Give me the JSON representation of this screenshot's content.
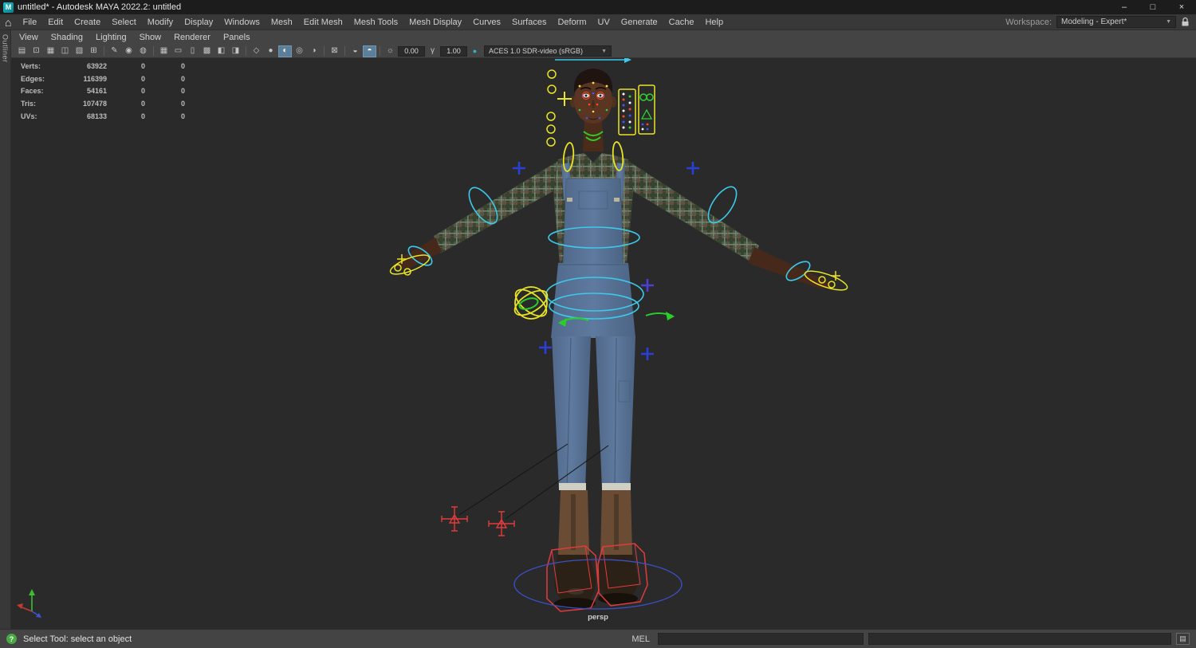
{
  "window": {
    "logo_glyph": "M",
    "title": "untitled* - Autodesk MAYA 2022.2: untitled",
    "controls": {
      "minimize": "–",
      "maximize": "□",
      "close": "×"
    }
  },
  "menu_bar": {
    "home_glyph": "⌂",
    "menus": [
      "File",
      "Edit",
      "Create",
      "Select",
      "Modify",
      "Display",
      "Windows",
      "Mesh",
      "Edit Mesh",
      "Mesh Tools",
      "Mesh Display",
      "Curves",
      "Surfaces",
      "Deform",
      "UV",
      "Generate",
      "Cache",
      "Help"
    ],
    "workspace_label": "Workspace:",
    "workspace_value": "Modeling - Expert*",
    "chevron": "▼"
  },
  "panel_menu": {
    "items": [
      "View",
      "Shading",
      "Lighting",
      "Show",
      "Renderer",
      "Panels"
    ]
  },
  "panel_toolbar": {
    "icons": [
      {
        "name": "select-camera",
        "glyph": "▤"
      },
      {
        "name": "lock-camera",
        "glyph": "⊡"
      },
      {
        "name": "camera-attributes",
        "glyph": "▦"
      },
      {
        "name": "bookmarks",
        "glyph": "◫"
      },
      {
        "name": "image-plane",
        "glyph": "▧"
      },
      {
        "name": "2d-pan-zoom",
        "glyph": "⊞"
      },
      {
        "name": "grease-pencil",
        "glyph": "✎"
      },
      {
        "name": "joints-display",
        "glyph": "◉"
      },
      {
        "name": "deformers-display",
        "glyph": "◍"
      },
      {
        "name": "grid",
        "glyph": "▦"
      },
      {
        "name": "film-gate",
        "glyph": "▭"
      },
      {
        "name": "resolution-gate",
        "glyph": "▯"
      },
      {
        "name": "gate-mask",
        "glyph": "▩"
      },
      {
        "name": "safe-action",
        "glyph": "◧"
      },
      {
        "name": "safe-title",
        "glyph": "◨"
      },
      {
        "name": "wireframe",
        "glyph": "◇"
      },
      {
        "name": "smooth-shade",
        "glyph": "●"
      },
      {
        "name": "textured",
        "glyph": "◐",
        "active": true
      },
      {
        "name": "use-default-material",
        "glyph": "◎"
      },
      {
        "name": "shadows",
        "glyph": "◑"
      },
      {
        "name": "isolate-select",
        "glyph": "⊠"
      },
      {
        "name": "xray",
        "glyph": "◒"
      },
      {
        "name": "lighting",
        "glyph": "◓",
        "active": true
      },
      {
        "name": "exposure",
        "glyph": "☼"
      },
      {
        "name": "gamma",
        "glyph": "γ"
      },
      {
        "name": "colorspace",
        "glyph": "●"
      }
    ],
    "exposure_value": "0.00",
    "gamma_value": "1.00",
    "colorspace": "ACES 1.0 SDR-video (sRGB)"
  },
  "side_tab": "Outliner",
  "hud": {
    "rows": [
      {
        "label": "Verts:",
        "v1": "63922",
        "v2": "0",
        "v3": "0"
      },
      {
        "label": "Edges:",
        "v1": "116399",
        "v2": "0",
        "v3": "0"
      },
      {
        "label": "Faces:",
        "v1": "54161",
        "v2": "0",
        "v3": "0"
      },
      {
        "label": "Tris:",
        "v1": "107478",
        "v2": "0",
        "v3": "0"
      },
      {
        "label": "UVs:",
        "v1": "68133",
        "v2": "0",
        "v3": "0"
      }
    ]
  },
  "viewport": {
    "camera": "persp"
  },
  "status_bar": {
    "help_glyph": "?",
    "help": "Select Tool: select an object",
    "mel_label": "MEL",
    "script_editor_glyph": "▤"
  },
  "colors": {
    "control_yellow": "#e8e426",
    "control_cyan": "#3cc9ea",
    "control_green": "#28cf28",
    "control_red": "#e23b3b",
    "control_blue": "#2a3fd6",
    "highlight_blue": "#5b7e99"
  }
}
